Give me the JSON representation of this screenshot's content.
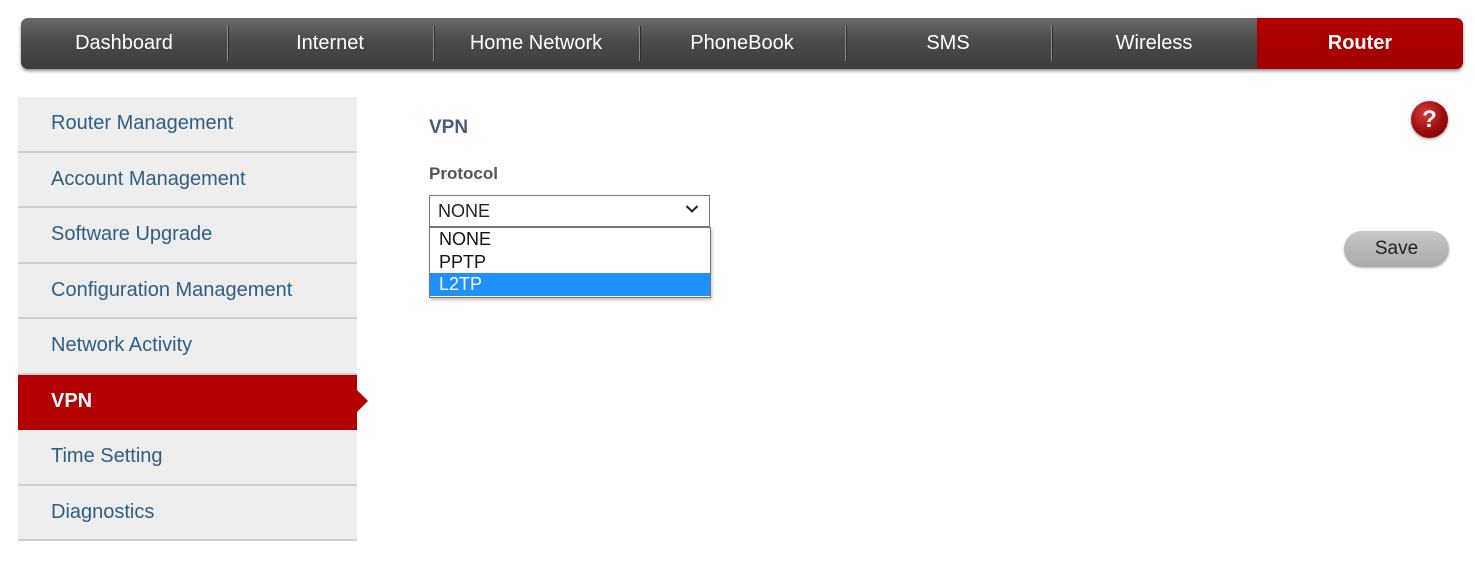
{
  "topnav": {
    "items": [
      {
        "label": "Dashboard"
      },
      {
        "label": "Internet"
      },
      {
        "label": "Home Network"
      },
      {
        "label": "PhoneBook"
      },
      {
        "label": "SMS"
      },
      {
        "label": "Wireless"
      },
      {
        "label": "Router",
        "active": true
      }
    ]
  },
  "sidebar": {
    "items": [
      {
        "label": "Router Management"
      },
      {
        "label": "Account Management"
      },
      {
        "label": "Software Upgrade"
      },
      {
        "label": "Configuration Management"
      },
      {
        "label": "Network Activity"
      },
      {
        "label": "VPN",
        "active": true
      },
      {
        "label": "Time Setting"
      },
      {
        "label": "Diagnostics"
      }
    ]
  },
  "content": {
    "title": "VPN",
    "protocol_label": "Protocol",
    "protocol_value": "NONE",
    "protocol_options": [
      "NONE",
      "PPTP",
      "L2TP"
    ],
    "highlighted_option": "L2TP",
    "help_symbol": "?",
    "save_label": "Save"
  },
  "colors": {
    "accent": "#b30000",
    "nav_dark": "#4b4b4b",
    "sidebar_text": "#2f5e85",
    "highlight": "#1e90ff"
  },
  "icons": {
    "help": "question-mark-icon",
    "dropdown": "chevron-down-icon"
  }
}
